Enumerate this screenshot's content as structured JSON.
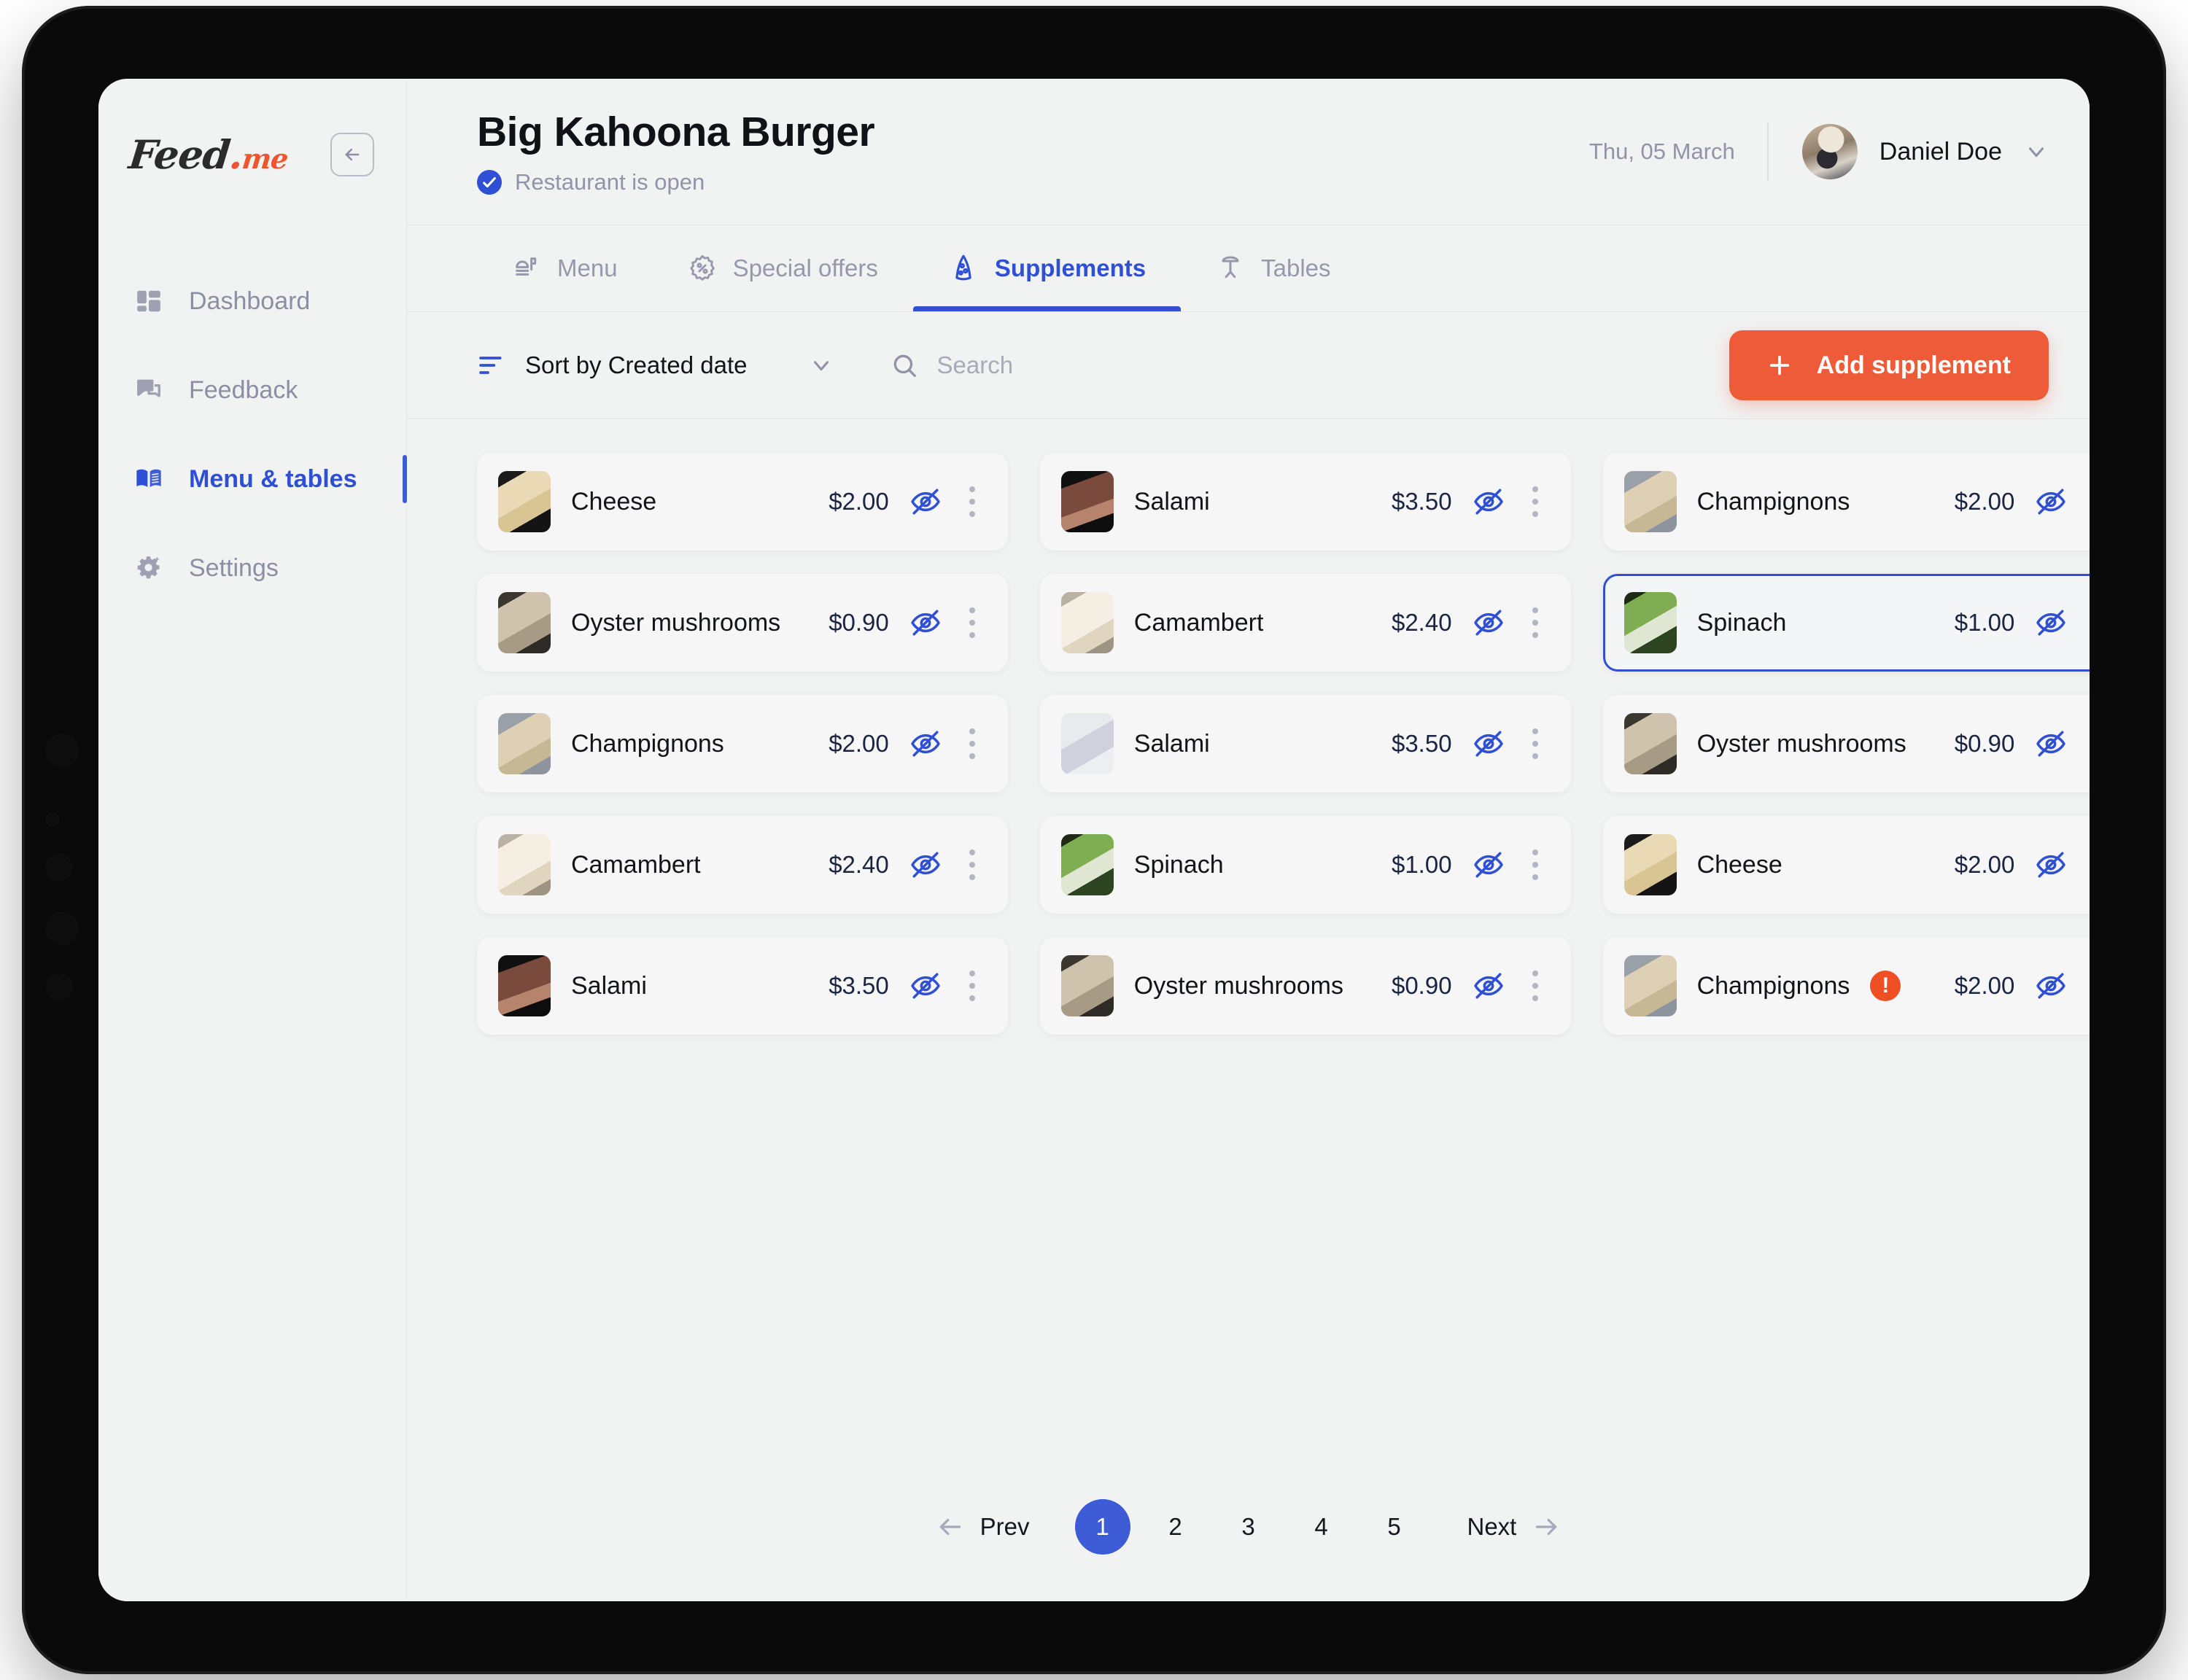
{
  "brand": {
    "name_primary": "Feed",
    "name_dot": ".",
    "name_secondary": "me"
  },
  "sidebar": {
    "collapse_icon": "arrow-left-icon",
    "items": [
      {
        "label": "Dashboard",
        "icon": "dashboard-icon",
        "active": false
      },
      {
        "label": "Feedback",
        "icon": "chat-icon",
        "active": false
      },
      {
        "label": "Menu & tables",
        "icon": "book-icon",
        "active": true
      },
      {
        "label": "Settings",
        "icon": "gear-icon",
        "active": false
      }
    ]
  },
  "header": {
    "title": "Big Kahoona Burger",
    "status": "Restaurant is open",
    "status_icon": "check-circle-icon",
    "date": "Thu, 05 March",
    "user_name": "Daniel Doe",
    "user_chevron": "chevron-down-icon"
  },
  "tabs": [
    {
      "label": "Menu",
      "icon": "burger-icon",
      "active": false
    },
    {
      "label": "Special offers",
      "icon": "discount-icon",
      "active": false
    },
    {
      "label": "Supplements",
      "icon": "pizza-slice-icon",
      "active": true
    },
    {
      "label": "Tables",
      "icon": "table-icon",
      "active": false
    }
  ],
  "toolbar": {
    "sort_label": "Sort by Created date",
    "sort_icon": "sort-icon",
    "sort_chevron": "chevron-down-icon",
    "search_placeholder": "Search",
    "search_icon": "search-icon",
    "add_label": "Add supplement",
    "add_icon": "plus-icon",
    "add_color": "#ee5b38"
  },
  "accent_colors": {
    "primary_blue": "#2f50d4",
    "pagination_blue": "#3c5bd4",
    "orange": "#ee5b38",
    "alert_red": "#ee4f24",
    "muted_text": "#9094a6"
  },
  "supplements": [
    {
      "name": "Cheese",
      "price": "$2.00",
      "thumb": "t-cheese",
      "alert": false,
      "selected": false,
      "visibility_icon": "eye-off-icon"
    },
    {
      "name": "Salami",
      "price": "$3.50",
      "thumb": "t-salami",
      "alert": false,
      "selected": false,
      "visibility_icon": "eye-off-icon"
    },
    {
      "name": "Champignons",
      "price": "$2.00",
      "thumb": "t-champ",
      "alert": false,
      "selected": false,
      "visibility_icon": "eye-off-icon"
    },
    {
      "name": "Oyster mushrooms",
      "price": "$0.90",
      "thumb": "t-oyster",
      "alert": false,
      "selected": false,
      "visibility_icon": "eye-off-icon"
    },
    {
      "name": "Camambert",
      "price": "$2.40",
      "thumb": "t-camambert",
      "alert": false,
      "selected": false,
      "visibility_icon": "eye-off-icon"
    },
    {
      "name": "Spinach",
      "price": "$1.00",
      "thumb": "t-spinach",
      "alert": false,
      "selected": true,
      "visibility_icon": "eye-off-icon"
    },
    {
      "name": "Champignons",
      "price": "$2.00",
      "thumb": "t-champ",
      "alert": false,
      "selected": false,
      "visibility_icon": "eye-off-icon"
    },
    {
      "name": "Salami",
      "price": "$3.50",
      "thumb": "t-salami2",
      "alert": false,
      "selected": false,
      "visibility_icon": "eye-off-icon"
    },
    {
      "name": "Oyster mushrooms",
      "price": "$0.90",
      "thumb": "t-oyster",
      "alert": false,
      "selected": false,
      "visibility_icon": "eye-off-icon"
    },
    {
      "name": "Camambert",
      "price": "$2.40",
      "thumb": "t-camambert",
      "alert": false,
      "selected": false,
      "visibility_icon": "eye-off-icon"
    },
    {
      "name": "Spinach",
      "price": "$1.00",
      "thumb": "t-spinach",
      "alert": false,
      "selected": false,
      "visibility_icon": "eye-off-icon"
    },
    {
      "name": "Cheese",
      "price": "$2.00",
      "thumb": "t-cheese",
      "alert": false,
      "selected": false,
      "visibility_icon": "eye-off-icon"
    },
    {
      "name": "Salami",
      "price": "$3.50",
      "thumb": "t-salami",
      "alert": false,
      "selected": false,
      "visibility_icon": "eye-off-icon"
    },
    {
      "name": "Oyster mushrooms",
      "price": "$0.90",
      "thumb": "t-oyster",
      "alert": false,
      "selected": false,
      "visibility_icon": "eye-off-icon"
    },
    {
      "name": "Champignons",
      "price": "$2.00",
      "thumb": "t-champ",
      "alert": true,
      "selected": false,
      "visibility_icon": "eye-off-icon"
    }
  ],
  "pagination": {
    "prev_label": "Prev",
    "next_label": "Next",
    "pages": [
      "1",
      "2",
      "3",
      "4",
      "5"
    ],
    "current": "1"
  }
}
